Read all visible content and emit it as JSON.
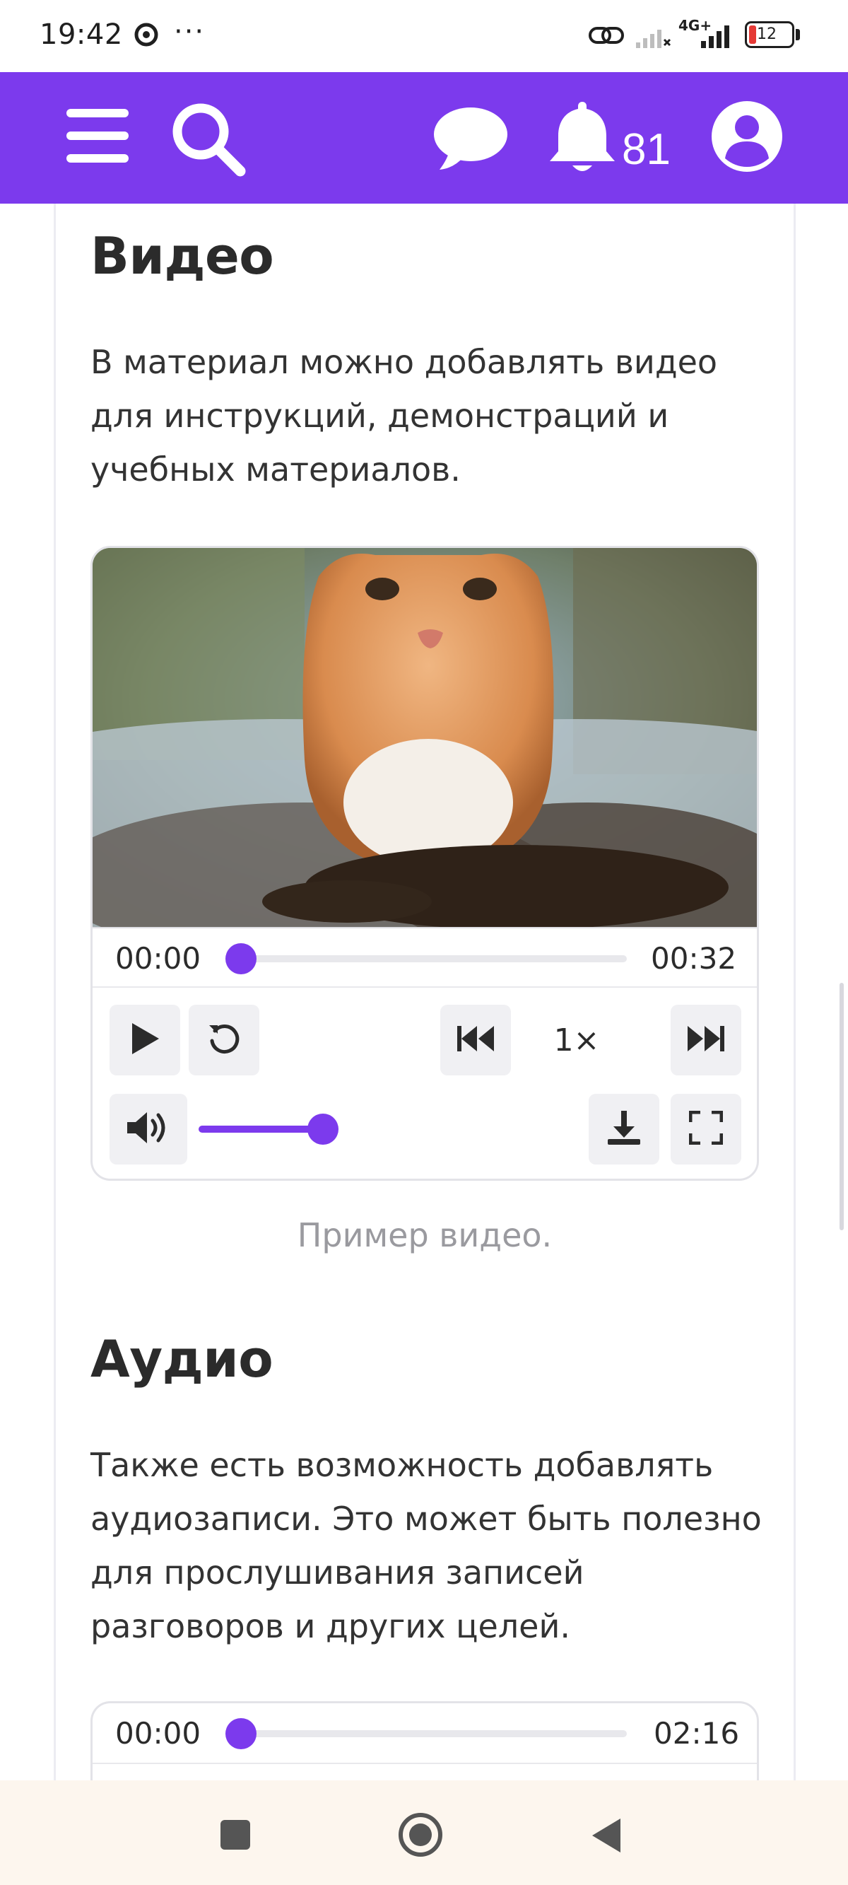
{
  "status_bar": {
    "time": "19:42",
    "dots": "···",
    "network": "4G+",
    "battery": "12"
  },
  "header": {
    "notifications_count": "81",
    "icons": [
      "menu-icon",
      "search-icon",
      "chat-icon",
      "bell-icon",
      "account-icon"
    ],
    "accent": "#7c3aed"
  },
  "video_section": {
    "title": "Видео",
    "text": "В материал можно добавлять видео для инструкций, демонстраций и учебных материалов.",
    "player": {
      "current_time": "00:00",
      "duration": "00:32",
      "progress": 0.0,
      "speed": "1×",
      "volume": 1.0
    },
    "caption": "Пример видео."
  },
  "audio_section": {
    "title": "Аудио",
    "text": "Также есть возможность добавлять аудиозаписи. Это может быть полезно для прослушивания записей разговоров и других целей.",
    "player": {
      "current_time": "00:00",
      "duration": "02:16",
      "progress": 0.0
    }
  },
  "nav_bar": {
    "buttons": [
      "recents-button",
      "home-button",
      "back-button"
    ]
  }
}
